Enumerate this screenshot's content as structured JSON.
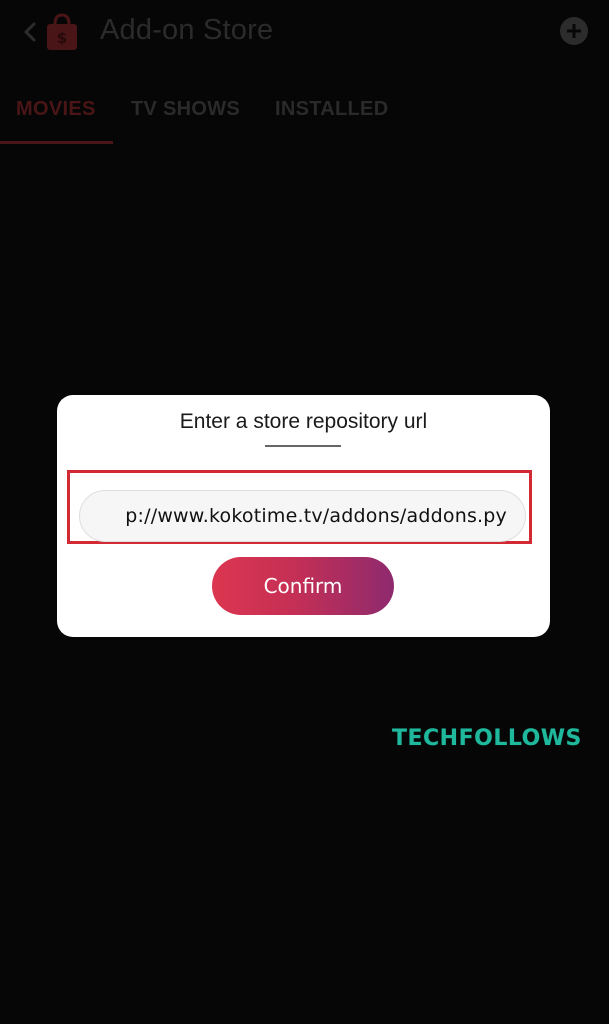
{
  "header": {
    "title": "Add-on Store",
    "back_icon": "chevron-left-icon",
    "store_icon": "shopping-bag-icon",
    "add_icon": "plus-circle-icon"
  },
  "tabs": [
    {
      "label": "MOVIES",
      "active": true
    },
    {
      "label": "TV SHOWS",
      "active": false
    },
    {
      "label": "INSTALLED",
      "active": false
    }
  ],
  "dialog": {
    "title": "Enter a store repository url",
    "url_value": "p://www.kokotime.tv/addons/addons.py",
    "confirm_label": "Confirm"
  },
  "watermark": "TECHFOLLOWS",
  "colors": {
    "background": "#060606",
    "accent": "#d22a34",
    "button_start": "#dc3650",
    "button_end": "#8e2a6e",
    "watermark": "#1fb89c"
  }
}
